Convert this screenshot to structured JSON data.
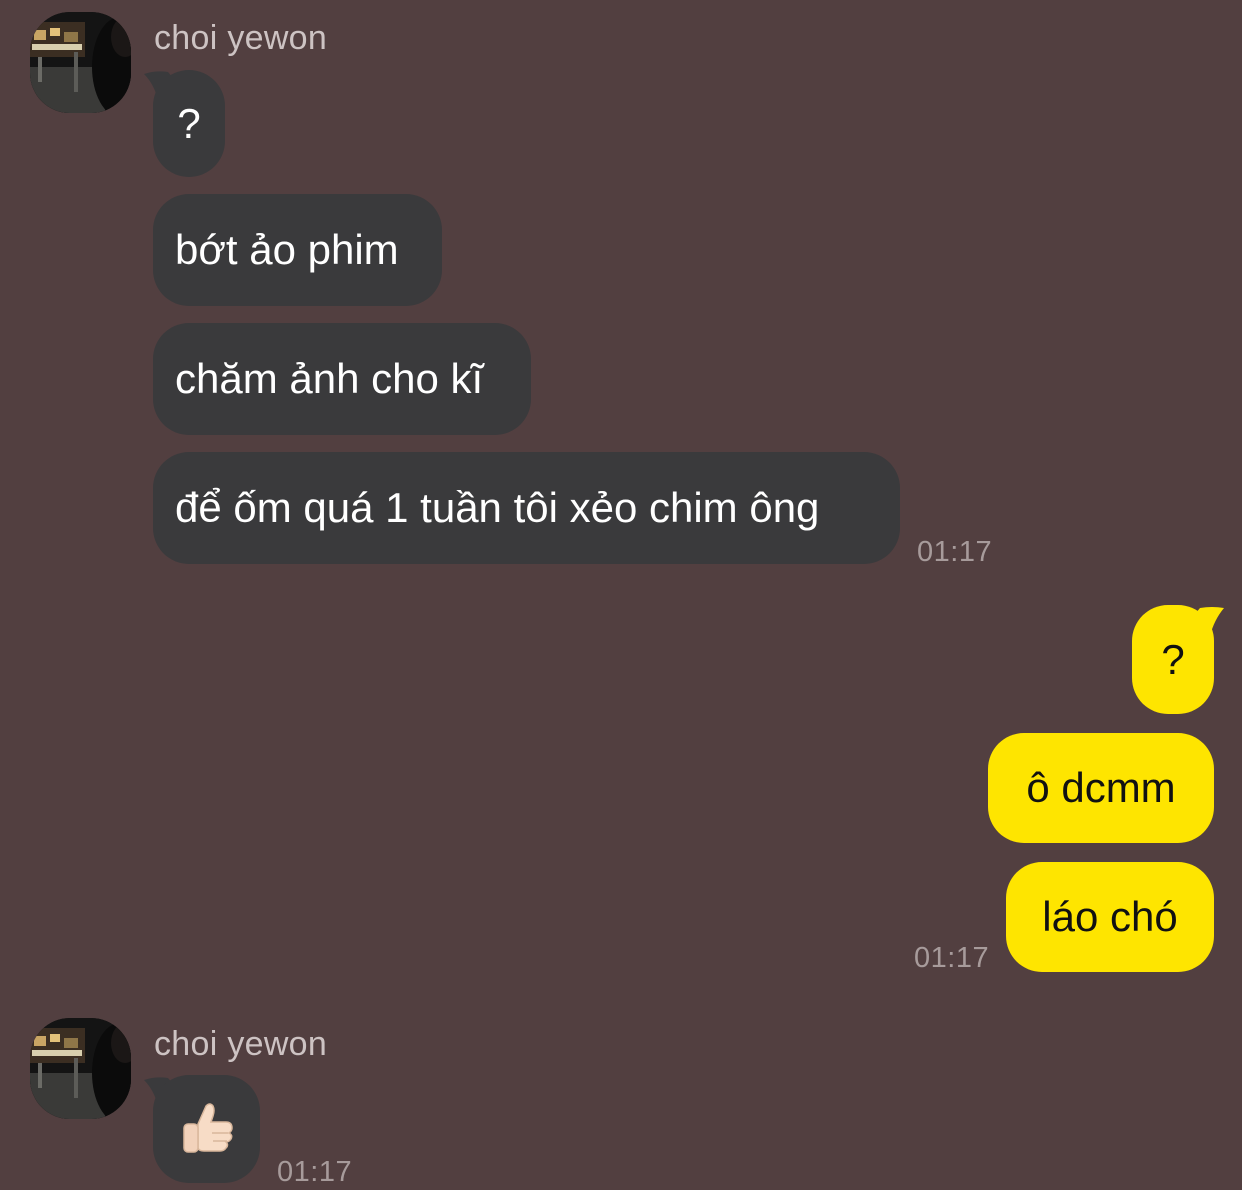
{
  "colors": {
    "background": "#523f40",
    "incoming_bubble": "#3a3a3c",
    "outgoing_bubble": "#fee500"
  },
  "group1": {
    "sender": "choi yewon",
    "messages": [
      "?",
      "bớt ảo phim",
      "chăm ảnh cho kĩ",
      "để ốm quá 1 tuần tôi xẻo chim ông"
    ],
    "time": "01:17"
  },
  "group2": {
    "messages": [
      "?",
      "ô dcmm",
      "láo chó"
    ],
    "time": "01:17"
  },
  "group3": {
    "sender": "choi yewon",
    "emoji_icon": "thumbs-up-icon",
    "time": "01:17"
  }
}
